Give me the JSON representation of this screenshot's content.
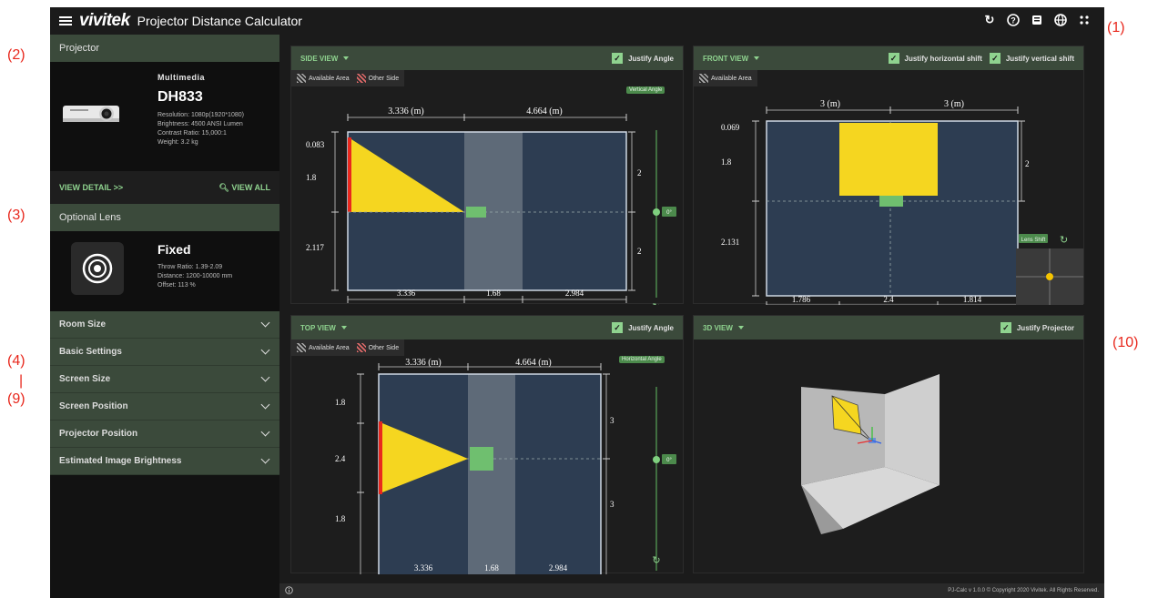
{
  "app": {
    "brand": "vivitek",
    "title": "Projector Distance Calculator"
  },
  "topbar_icons": [
    "refresh-icon",
    "help-icon",
    "manual-icon",
    "globe-icon",
    "settings-icon"
  ],
  "sidebar": {
    "projector": {
      "header": "Projector",
      "category": "Multimedia",
      "model": "DH833",
      "specs": [
        "Resolution: 1080p(1920*1080)",
        "Brightness: 4500 ANSI Lumen",
        "Contrast Ratio: 15,000:1",
        "Weight: 3.2 kg"
      ],
      "view_detail": "VIEW DETAIL >>",
      "view_all": "VIEW ALL"
    },
    "lens": {
      "header": "Optional Lens",
      "name": "Fixed",
      "specs": [
        "Throw Ratio: 1.39-2.09",
        "Distance: 1200-10000 mm",
        "Offset: 113 %"
      ]
    },
    "accordion": [
      "Room Size",
      "Basic Settings",
      "Screen Size",
      "Screen Position",
      "Projector Position",
      "Estimated Image Brightness"
    ]
  },
  "side_view": {
    "title": "SIDE VIEW",
    "justify_label": "Justify Angle",
    "legend_available": "Available Area",
    "legend_other": "Other Side",
    "angle_tag": "Vertical Angle",
    "angle_value": "0°",
    "top_dims": [
      "3.336 (m)",
      "4.664 (m)"
    ],
    "left_dims": [
      "0.083",
      "1.8",
      "2.117"
    ],
    "right_dims": [
      "2",
      "2"
    ],
    "bottom_dims": [
      "3.336",
      "1.68",
      "2.984"
    ]
  },
  "front_view": {
    "title": "FRONT VIEW",
    "justify_h": "Justify horizontal shift",
    "justify_v": "Justify vertical shift",
    "legend_available": "Available Area",
    "lens_shift": "Lens Shift",
    "top_dims": [
      "3 (m)",
      "3 (m)"
    ],
    "left_dims": [
      "0.069",
      "1.8",
      "2.131"
    ],
    "right_dims": [
      "2"
    ],
    "bottom_dims": [
      "1.786",
      "2.4",
      "1.814"
    ]
  },
  "top_view": {
    "title": "TOP VIEW",
    "justify_label": "Justify Angle",
    "legend_available": "Available Area",
    "legend_other": "Other Side",
    "angle_tag": "Horizontal Angle",
    "angle_value": "0°",
    "top_dims": [
      "3.336 (m)",
      "4.664 (m)"
    ],
    "left_dims": [
      "1.8",
      "2.4",
      "1.8"
    ],
    "right_dims": [
      "3",
      "3"
    ],
    "bottom_dims": [
      "3.336",
      "1.68",
      "2.984"
    ]
  },
  "view_3d": {
    "title": "3D VIEW",
    "justify_label": "Justify Projector"
  },
  "footer": {
    "copyright": "PJ-Calc v 1.0.0 © Copyright 2020 Vivitek. All Rights Reserved."
  },
  "annotations": [
    "(1)",
    "(2)",
    "(3)",
    "(4)",
    "|",
    "(9)",
    "(10)"
  ]
}
